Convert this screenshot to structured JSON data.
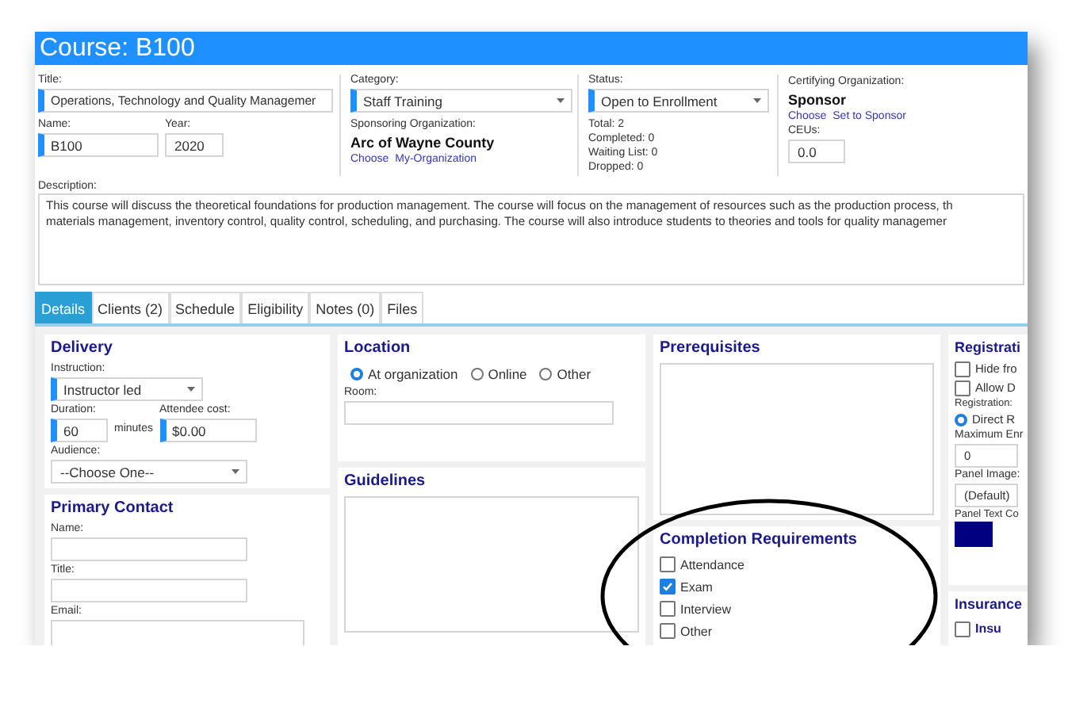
{
  "window": {
    "title": "Course: B100"
  },
  "header": {
    "title": {
      "label": "Title:",
      "value": "Operations, Technology and Quality Managemer",
      "required": true
    },
    "name": {
      "label": "Name:",
      "value": "B100",
      "required": true
    },
    "year": {
      "label": "Year:",
      "value": "2020",
      "required": false
    },
    "category": {
      "label": "Category:",
      "value": "Staff Training",
      "required": true
    },
    "sponsoring_organization": {
      "label": "Sponsoring Organization:",
      "value": "Arc of Wayne County",
      "links": [
        "Choose",
        "My-Organization"
      ]
    },
    "status": {
      "label": "Status:",
      "value": "Open to Enrollment",
      "required": true,
      "counts": [
        "Total: 2",
        "Completed: 0",
        "Waiting List: 0",
        "Dropped: 0"
      ]
    },
    "certifying_organization": {
      "label": "Certifying Organization:",
      "value": "Sponsor",
      "links": [
        "Choose",
        "Set to Sponsor"
      ]
    },
    "ceus": {
      "label": "CEUs:",
      "value": "0.0",
      "required": false
    }
  },
  "description": {
    "label": "Description:",
    "lines": [
      "This course will discuss the theoretical foundations for production management. The course will focus on the management of resources such as the production process, th",
      "materials management, inventory control, quality control, scheduling, and purchasing. The course will also introduce students to theories and tools for quality managemer"
    ]
  },
  "tabs": [
    {
      "label": "Details",
      "selected": true
    },
    {
      "label": "Clients (2)",
      "selected": false
    },
    {
      "label": "Schedule",
      "selected": false
    },
    {
      "label": "Eligibility",
      "selected": false
    },
    {
      "label": "Notes (0)",
      "selected": false
    },
    {
      "label": "Files",
      "selected": false
    }
  ],
  "delivery": {
    "heading": "Delivery",
    "instruction": {
      "label": "Instruction:",
      "value": "Instructor led",
      "required": true
    },
    "duration": {
      "label": "Duration:",
      "value": "60",
      "unit": "minutes",
      "required": true
    },
    "attendee_cost": {
      "label": "Attendee cost:",
      "value": "$0.00",
      "required": true
    },
    "audience": {
      "label": "Audience:",
      "value": "--Choose One--",
      "required": false
    }
  },
  "primary_contact": {
    "heading": "Primary Contact",
    "fields": [
      {
        "label": "Name:"
      },
      {
        "label": "Title:"
      },
      {
        "label": "Email:"
      }
    ]
  },
  "location": {
    "heading": "Location",
    "options": [
      {
        "label": "At organization",
        "selected": true
      },
      {
        "label": "Online",
        "selected": false
      },
      {
        "label": "Other",
        "selected": false
      }
    ],
    "room": {
      "label": "Room:"
    }
  },
  "guidelines": {
    "heading": "Guidelines"
  },
  "prerequisites": {
    "heading": "Prerequisites"
  },
  "completion_requirements": {
    "heading": "Completion Requirements",
    "items": [
      {
        "label": "Attendance",
        "checked": false
      },
      {
        "label": "Exam",
        "checked": true
      },
      {
        "label": "Interview",
        "checked": false
      },
      {
        "label": "Other",
        "checked": false
      }
    ]
  },
  "registration": {
    "heading": "Registrati",
    "options": [
      {
        "label": "Hide fro",
        "checked": false
      },
      {
        "label": "Allow D",
        "checked": false
      }
    ],
    "registration": {
      "label": "Registration:",
      "options": [
        {
          "label": "Direct R",
          "selected": true
        }
      ]
    },
    "maximum": {
      "label": "Maximum Enr",
      "value": "0"
    },
    "panel_image": {
      "label": "Panel Image:",
      "value": "(Default)"
    },
    "panel_text_color": {
      "label": "Panel Text Co",
      "color": "#000080"
    }
  },
  "insurance": {
    "heading": "Insurance",
    "items": [
      {
        "label": "Insu",
        "checked": false
      }
    ]
  }
}
